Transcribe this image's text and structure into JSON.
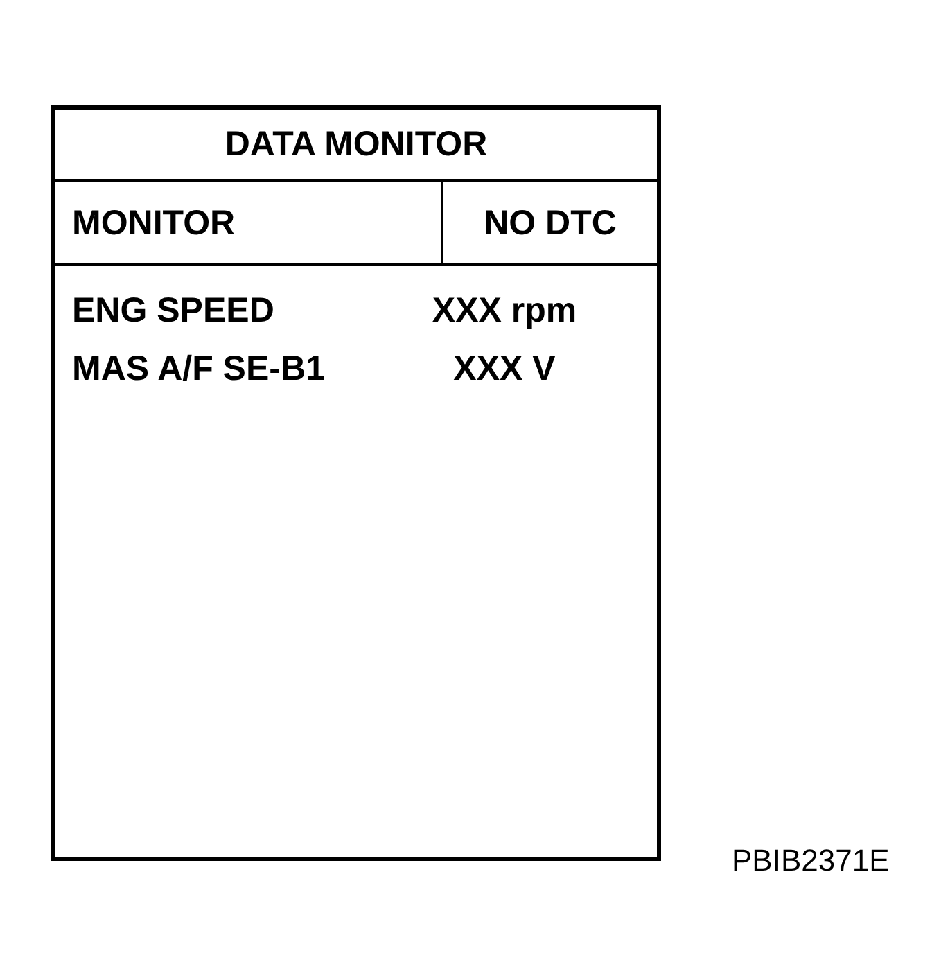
{
  "panel": {
    "title": "DATA MONITOR",
    "header": {
      "mode": "MONITOR",
      "status": "NO DTC"
    },
    "items": [
      {
        "name": "ENG SPEED",
        "value": "XXX rpm"
      },
      {
        "name": "MAS A/F SE-B1",
        "value": "XXX V"
      }
    ]
  },
  "figure_code": "PBIB2371E"
}
